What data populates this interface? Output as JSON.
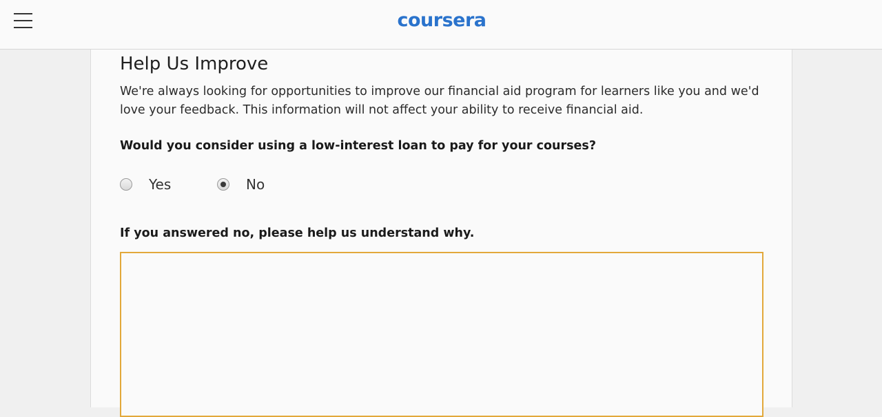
{
  "header": {
    "menu_icon": "hamburger-menu-icon",
    "logo_text": "coursera",
    "brand_color": "#2a73cc"
  },
  "form": {
    "title": "Help Us Improve",
    "intro": "We're always looking for opportunities to improve our financial aid program for learners like you and we'd love your feedback. This information will not affect your ability to receive financial aid.",
    "question_loan": "Would you consider using a low-interest loan to pay for your courses?",
    "options": [
      {
        "label": "Yes",
        "selected": false
      },
      {
        "label": "No",
        "selected": true
      }
    ],
    "question_why": "If you answered no, please help us understand why.",
    "feedback_value": "",
    "focus_color": "#e2a83a"
  }
}
